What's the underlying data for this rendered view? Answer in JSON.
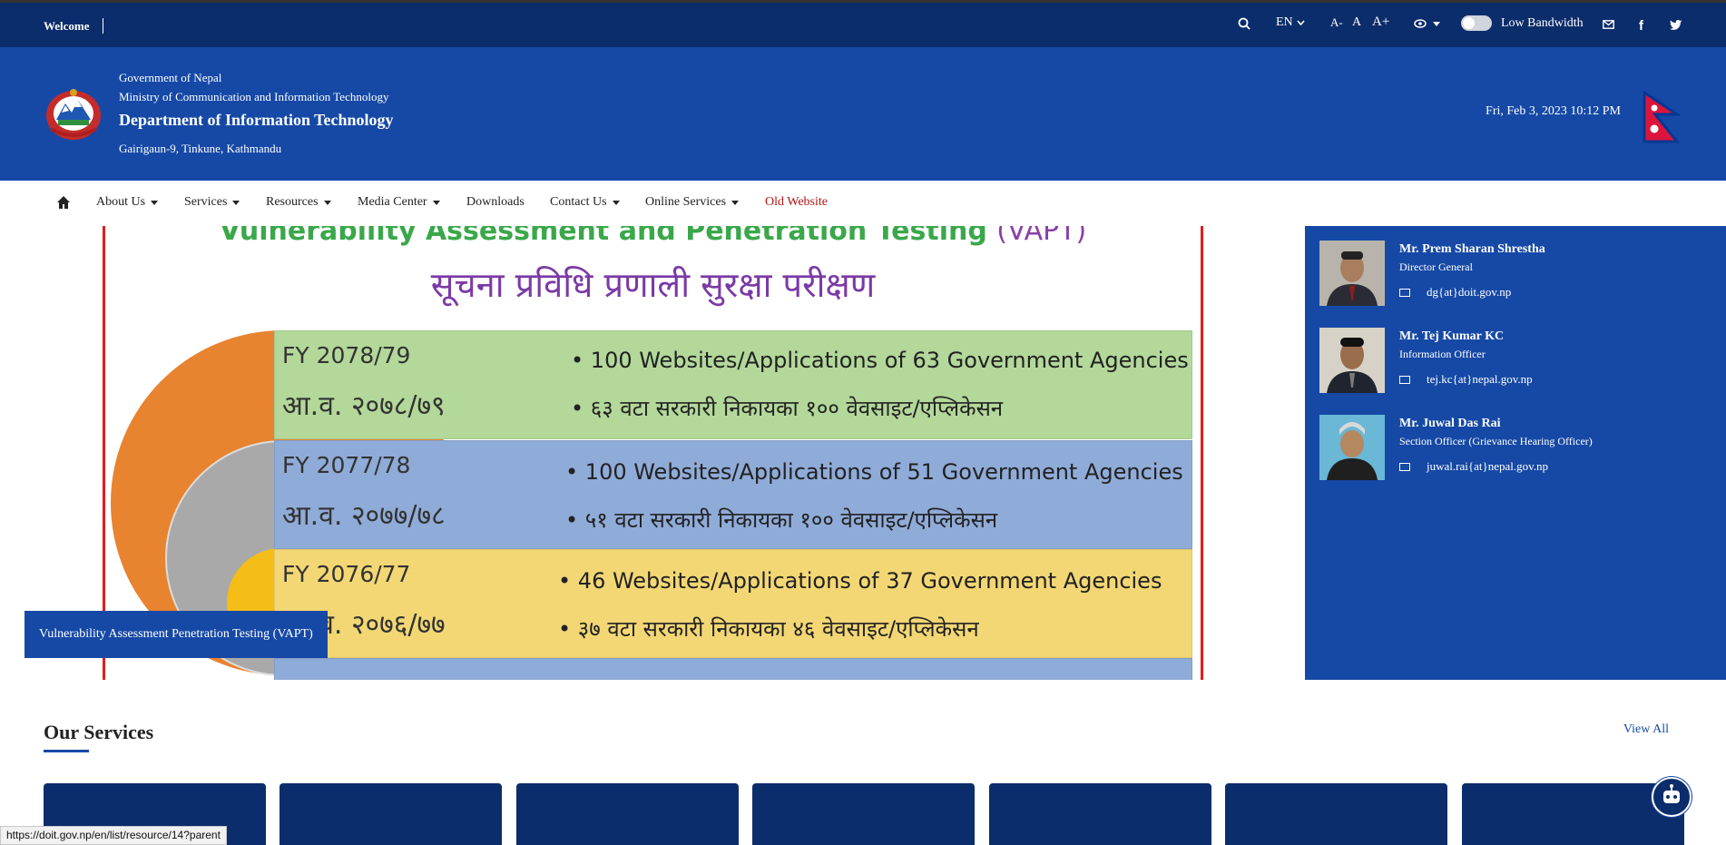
{
  "topbar": {
    "welcome": "Welcome",
    "language": "EN",
    "font_small": "A-",
    "font_normal": "A",
    "font_large": "A+",
    "low_bandwidth": "Low Bandwidth"
  },
  "header": {
    "line1": "Government of Nepal",
    "line2": "Ministry of Communication and Information Technology",
    "title": "Department of Information Technology",
    "address": "Gairigaun-9, Tinkune, Kathmandu",
    "datetime": "Fri, Feb 3, 2023 10:12 PM"
  },
  "nav": {
    "items": [
      {
        "label": "About Us",
        "dropdown": true
      },
      {
        "label": "Services",
        "dropdown": true
      },
      {
        "label": "Resources",
        "dropdown": true
      },
      {
        "label": "Media Center",
        "dropdown": true
      },
      {
        "label": "Downloads",
        "dropdown": false
      },
      {
        "label": "Contact Us",
        "dropdown": true
      },
      {
        "label": "Online Services",
        "dropdown": true
      },
      {
        "label": "Old Website",
        "dropdown": false
      }
    ]
  },
  "slider": {
    "heading_en": "Vulnerability Assessment and Penetration Testing",
    "heading_abbr": "(VAPT)",
    "heading_np": "सूचना प्रविधि प्रणाली सुरक्षा परीक्षण",
    "rows": [
      {
        "fy": "FY 2078/79",
        "fy_np": "आ.व. २०७८/७९",
        "en": "100 Websites/Applications of 63 Government Agencies",
        "np": "६३ वटा सरकारी निकायका १०० वेवसाइट/एप्लिकेसन",
        "color": "#b3d89a"
      },
      {
        "fy": "FY 2077/78",
        "fy_np": "आ.व. २०७७/७८",
        "en": "100 Websites/Applications of 51 Government Agencies",
        "np": "५१ वटा सरकारी निकायका १०० वेवसाइट/एप्लिकेसन",
        "color": "#8fabd8"
      },
      {
        "fy": "FY 2076/77",
        "fy_np": "आ.व. २०७६/७७",
        "en": "46 Websites/Applications of 37 Government Agencies",
        "np": "३७ वटा सरकारी निकायका ४६ वेवसाइट/एप्लिकेसन",
        "color": "#f3d774"
      }
    ],
    "caption": "Vulnerability Assessment Penetration Testing (VAPT)"
  },
  "officials": [
    {
      "name": "Mr. Prem Sharan Shrestha",
      "role": "Director General",
      "email": "dg{at}doit.gov.np"
    },
    {
      "name": "Mr. Tej Kumar KC",
      "role": "Information Officer",
      "email": "tej.kc{at}nepal.gov.np"
    },
    {
      "name": "Mr. Juwal Das Rai",
      "role": "Section Officer (Grievance Hearing Officer)",
      "email": "juwal.rai{at}nepal.gov.np"
    }
  ],
  "services": {
    "title": "Our Services",
    "view_all": "View All"
  },
  "status_url": "https://doit.gov.np/en/list/resource/14?parent",
  "colors": {
    "topbar": "#0c2d6b",
    "header": "#1649a6",
    "accent_red": "#e31d1d"
  }
}
